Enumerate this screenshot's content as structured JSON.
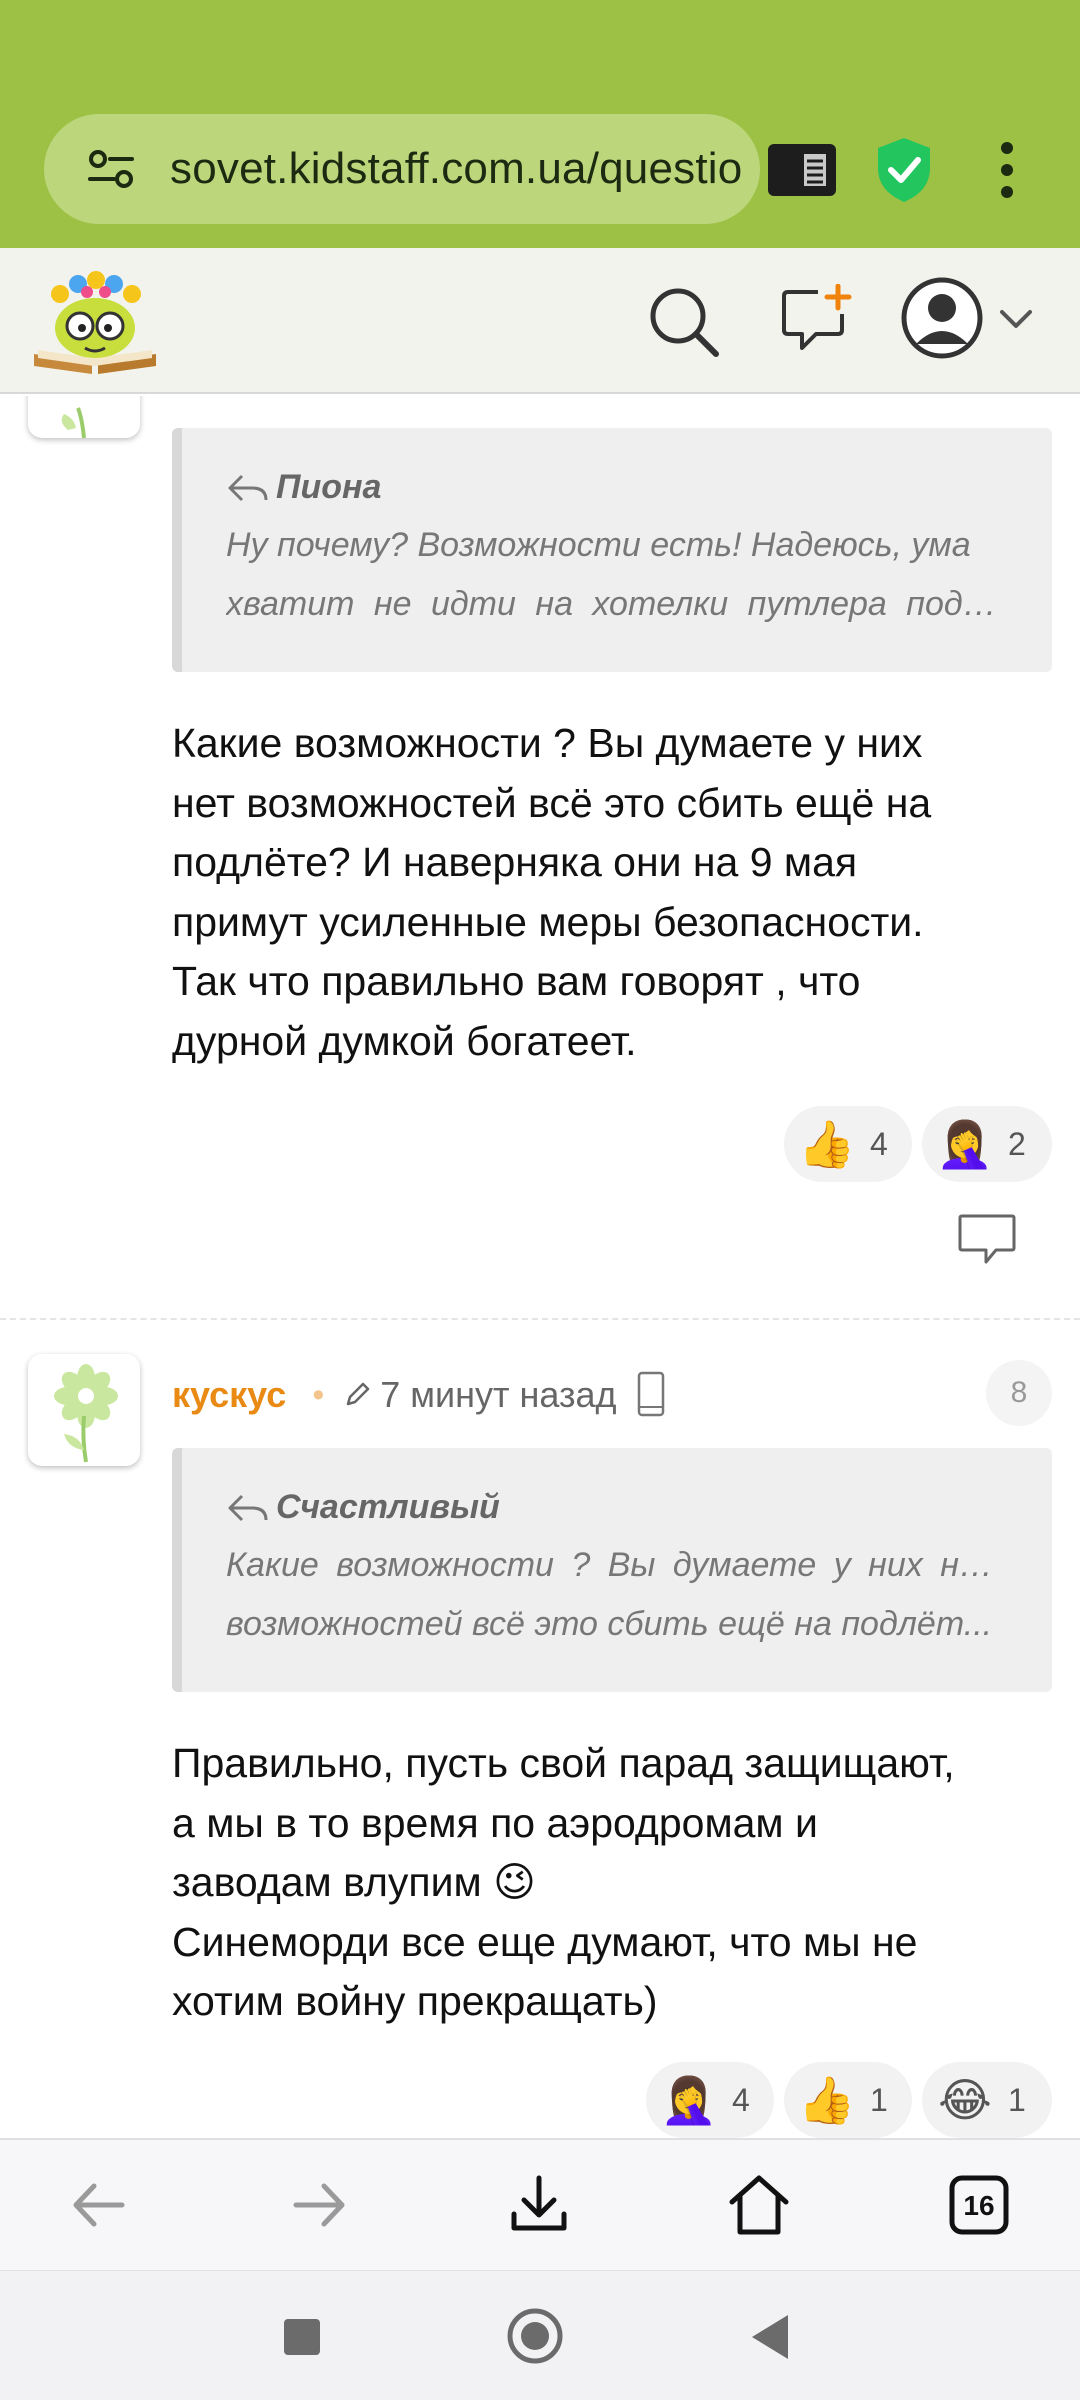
{
  "browser": {
    "url": "sovet.kidstaff.com.ua/questio",
    "tab_count": "16"
  },
  "posts": [
    {
      "quote_author": "Пиона",
      "quote_lines": [
        "Ну почему? Возможности есть! Надеюсь, ума",
        "хватит не идти на хотелки путлера подня..."
      ],
      "text_lines": [
        "Какие возможности ? Вы думаете у них",
        "нет возможностей всё это сбить ещё на",
        "подлёте? И наверняка они на 9 мая",
        "примут усиленные меры безопасности.",
        "Так что правильно вам говорят , что",
        "дурной думкой богатеет."
      ],
      "reactions": [
        {
          "emoji": "👍",
          "count": "4"
        },
        {
          "emoji": "🤦‍♀️",
          "count": "2"
        }
      ]
    },
    {
      "author": "кускус",
      "time": "7 минут назад",
      "number": "8",
      "quote_author": "Счастливый",
      "quote_lines": [
        "Какие возможности ? Вы думаете у них нет",
        "возможностей всё это сбить ещё на подлёт..."
      ],
      "text_lines": [
        "Правильно, пусть свой парад защищают,",
        "а мы в то время по аэродромам и",
        "заводам влупим 😉",
        "Синеморди все еще думают, что мы не",
        "хотим войну прекращать)"
      ],
      "reactions": [
        {
          "emoji": "🤦‍♀️",
          "count": "4"
        },
        {
          "emoji": "👍",
          "count": "1"
        },
        {
          "emoji": "😂",
          "count": "1"
        }
      ]
    }
  ]
}
